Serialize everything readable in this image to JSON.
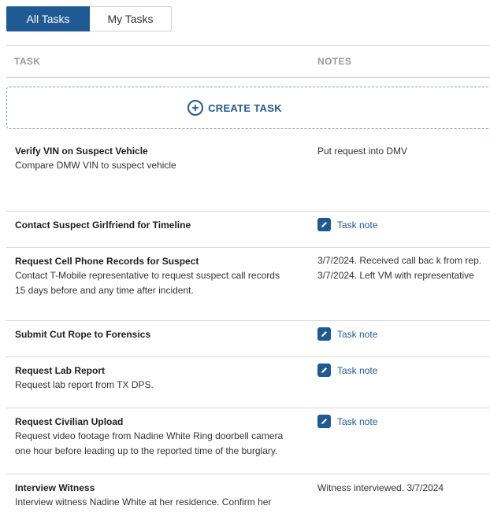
{
  "tabs": {
    "all": "All Tasks",
    "mine": "My Tasks"
  },
  "table": {
    "col_task": "TASK",
    "col_notes": "NOTES"
  },
  "create_label": "CREATE TASK",
  "task_note_label": "Task note",
  "rows": [
    {
      "title": "Verify VIN on Suspect Vehicle",
      "desc1": "Compare DMW VIN to suspect vehicle",
      "desc2": "",
      "note1": "Put request into DMV",
      "note2": ""
    },
    {
      "title": "Contact Suspect Girlfriend for Timeline",
      "desc1": "",
      "desc2": "",
      "note1": "",
      "note2": ""
    },
    {
      "title": "Request Cell Phone Records for Suspect",
      "desc1": "Contact T-Mobile representative to request suspect call records",
      "desc2": "15 days before and any time after incident.",
      "note1": "3/7/2024. Received call bac k from rep.",
      "note2": "3/7/2024. Left VM with representative"
    },
    {
      "title": "Submit Cut Rope to Forensics",
      "desc1": "",
      "desc2": "",
      "note1": "",
      "note2": ""
    },
    {
      "title": "Request Lab Report",
      "desc1": "Request lab report from TX DPS.",
      "desc2": "",
      "note1": "",
      "note2": ""
    },
    {
      "title": "Request Civilian Upload",
      "desc1": "Request video footage from Nadine White Ring doorbell camera",
      "desc2": "one hour before leading up to the reported time of the burglary.",
      "note1": "",
      "note2": ""
    },
    {
      "title": "Interview Witness",
      "desc1": "Interview witness Nadine White at her residence. Confirm her",
      "desc2": "",
      "note1": "Witness interviewed. 3/7/2024",
      "note2": ""
    }
  ]
}
